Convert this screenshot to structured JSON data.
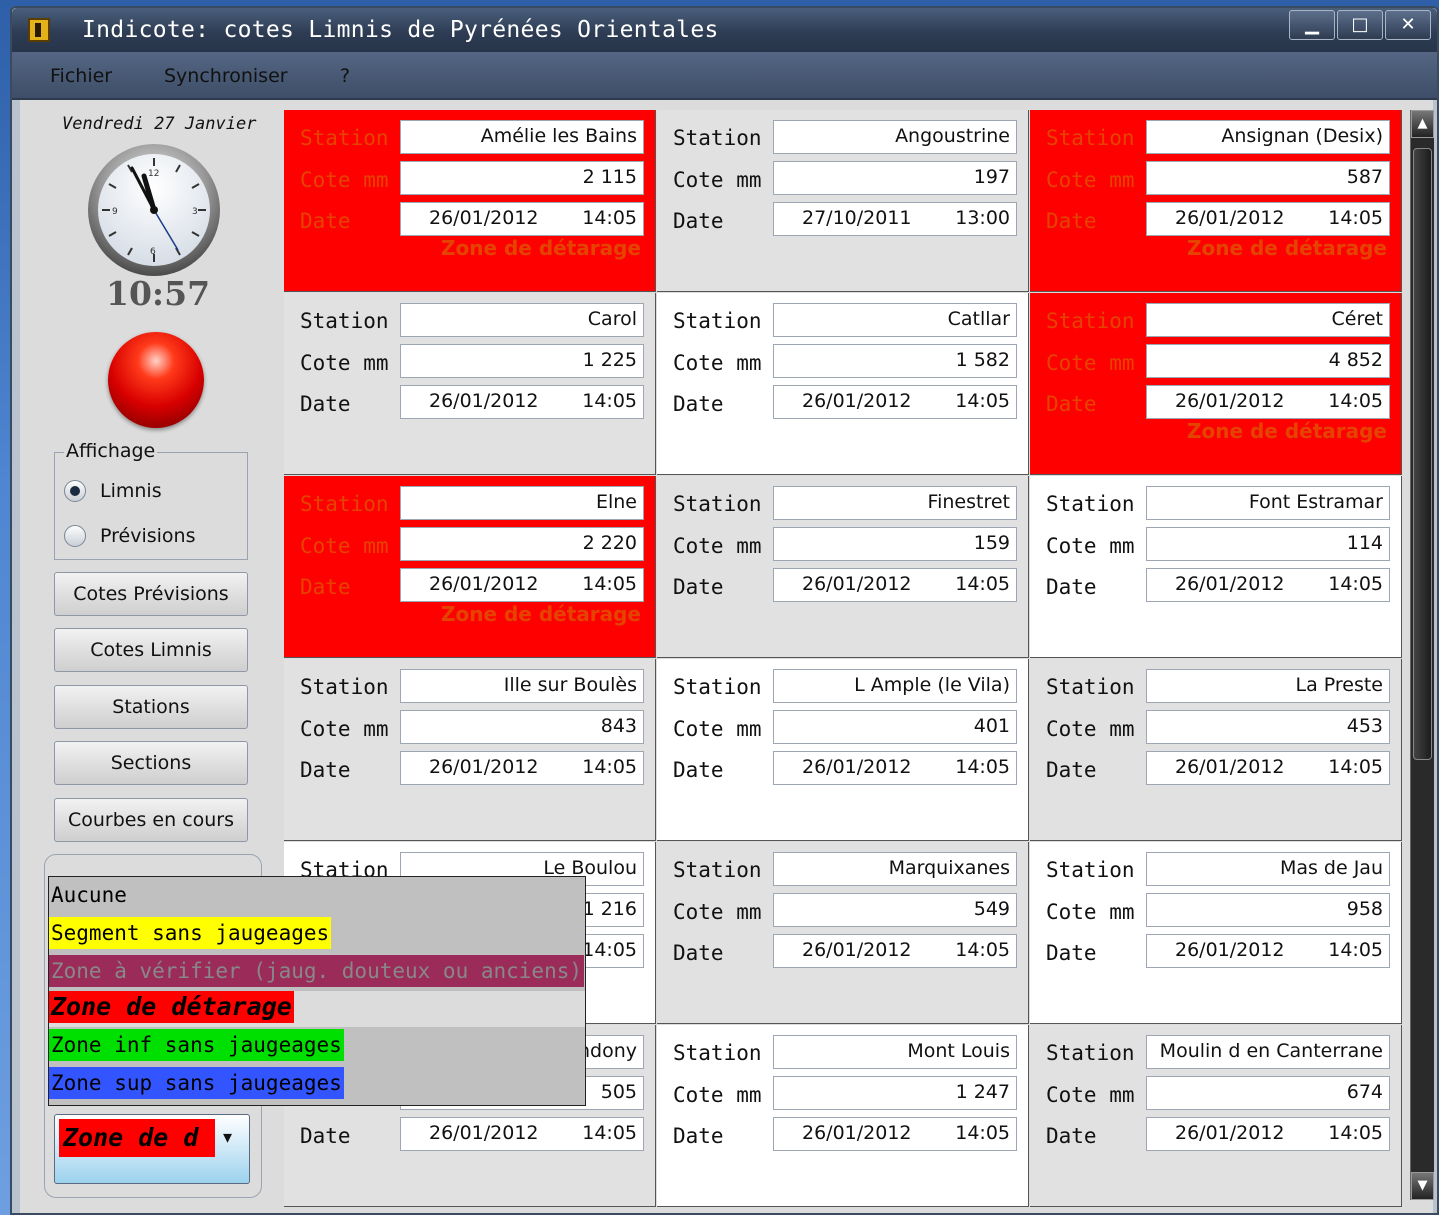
{
  "window": {
    "title": "Indicote:  cotes Limnis de Pyrénées Orientales"
  },
  "menu": {
    "fichier": "Fichier",
    "synchroniser": "Synchroniser",
    "help": "?"
  },
  "left": {
    "date": "Vendredi 27 Janvier",
    "time": "10:57",
    "display_group": "Affichage",
    "radio_limnis": "Limnis",
    "radio_previsions": "Prévisions",
    "radio_selected": "Limnis",
    "buttons": [
      "Cotes Prévisions",
      "Cotes Limnis",
      "Stations",
      "Sections",
      "Courbes en cours"
    ],
    "combo_value": "Zone de d"
  },
  "dropdown": {
    "items": [
      {
        "label": "Aucune",
        "bg": "",
        "color": "#000000"
      },
      {
        "label": "Segment sans jaugeages",
        "bg": "#ffff00",
        "color": "#000000"
      },
      {
        "label": "Zone à vérifier (jaug. douteux ou anciens)",
        "bg": "#9b2c5a",
        "color": "#888888"
      },
      {
        "label": "Zone de détarage",
        "bg": "#ff0000",
        "color": "#000000"
      },
      {
        "label": "Zone inf sans jaugeages",
        "bg": "#00e000",
        "color": "#000000"
      },
      {
        "label": "Zone sup sans jaugeages",
        "bg": "#3355ff",
        "color": "#000000"
      }
    ],
    "selected_index": 3
  },
  "labels": {
    "station": "Station",
    "cote": "Cote mm",
    "date": "Date",
    "zone": "Zone de détarage"
  },
  "stations": [
    {
      "name": "Amélie les Bains",
      "cote": "2 115",
      "date": "26/01/2012",
      "time": "14:05",
      "status": "red"
    },
    {
      "name": "Angoustrine",
      "cote": "197",
      "date": "27/10/2011",
      "time": "13:00",
      "status": "gray"
    },
    {
      "name": "Ansignan (Desix)",
      "cote": "587",
      "date": "26/01/2012",
      "time": "14:05",
      "status": "red"
    },
    {
      "name": "Carol",
      "cote": "1 225",
      "date": "26/01/2012",
      "time": "14:05",
      "status": "gray"
    },
    {
      "name": "Catllar",
      "cote": "1 582",
      "date": "26/01/2012",
      "time": "14:05",
      "status": "white"
    },
    {
      "name": "Céret",
      "cote": "4 852",
      "date": "26/01/2012",
      "time": "14:05",
      "status": "red"
    },
    {
      "name": "Elne",
      "cote": "2 220",
      "date": "26/01/2012",
      "time": "14:05",
      "status": "red"
    },
    {
      "name": "Finestret",
      "cote": "159",
      "date": "26/01/2012",
      "time": "14:05",
      "status": "gray"
    },
    {
      "name": "Font Estramar",
      "cote": "114",
      "date": "26/01/2012",
      "time": "14:05",
      "status": "white"
    },
    {
      "name": "Ille sur Boulès",
      "cote": "843",
      "date": "26/01/2012",
      "time": "14:05",
      "status": "gray"
    },
    {
      "name": "L Ample (le Vila)",
      "cote": "401",
      "date": "26/01/2012",
      "time": "14:05",
      "status": "white"
    },
    {
      "name": "La Preste",
      "cote": "453",
      "date": "26/01/2012",
      "time": "14:05",
      "status": "gray"
    },
    {
      "name": "Le Boulou",
      "cote": "1 216",
      "date": "",
      "time": "14:05",
      "status": "white"
    },
    {
      "name": "Marquixanes",
      "cote": "549",
      "date": "26/01/2012",
      "time": "14:05",
      "status": "gray"
    },
    {
      "name": "Mas de Jau",
      "cote": "958",
      "date": "26/01/2012",
      "time": "14:05",
      "status": "white"
    },
    {
      "name": "ndony",
      "cote": "505",
      "date": "26/01/2012",
      "time": "14:05",
      "status": "gray"
    },
    {
      "name": "Mont Louis",
      "cote": "1 247",
      "date": "26/01/2012",
      "time": "14:05",
      "status": "white"
    },
    {
      "name": "Moulin d en Canterrane",
      "cote": "674",
      "date": "26/01/2012",
      "time": "14:05",
      "status": "gray"
    }
  ]
}
